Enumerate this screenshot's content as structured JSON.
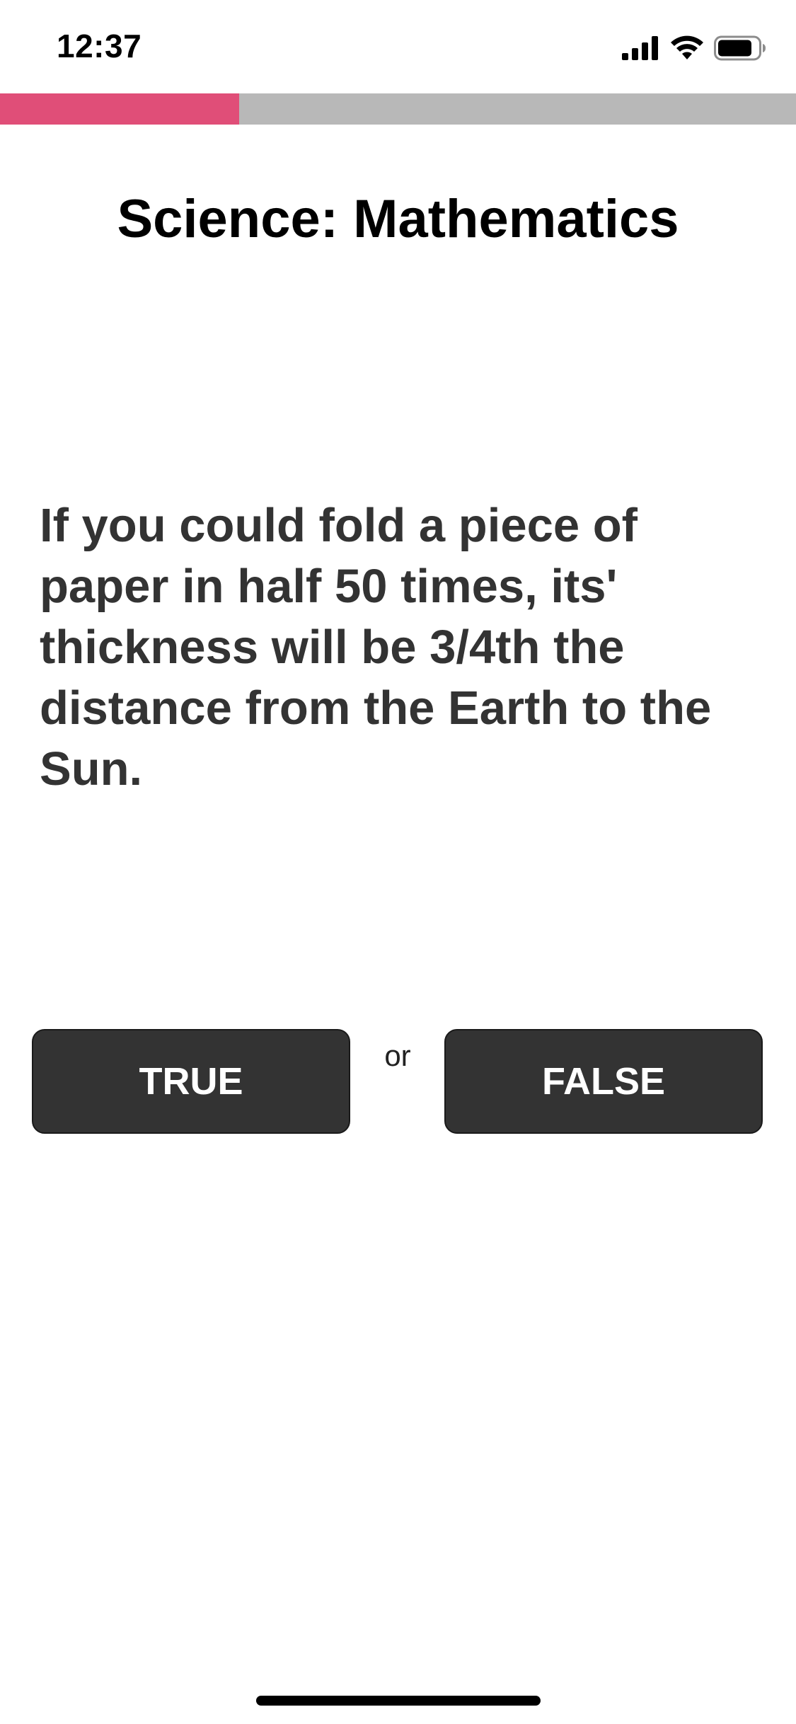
{
  "status_bar": {
    "time": "12:37",
    "icons": [
      "signal-icon",
      "wifi-icon",
      "battery-icon"
    ]
  },
  "progress": {
    "fraction": 0.3,
    "fill_color": "#e04e78",
    "track_color": "#b8b8b8"
  },
  "quiz": {
    "category_title": "Science: Mathematics",
    "question": "If you could fold a piece of paper in half 50 times, its' thickness will be 3/4th the distance from the Earth to the Sun.",
    "true_label": "TRUE",
    "separator": "or",
    "false_label": "FALSE"
  },
  "colors": {
    "button_background": "#333333",
    "button_text": "#ffffff",
    "question_text": "#333333"
  }
}
